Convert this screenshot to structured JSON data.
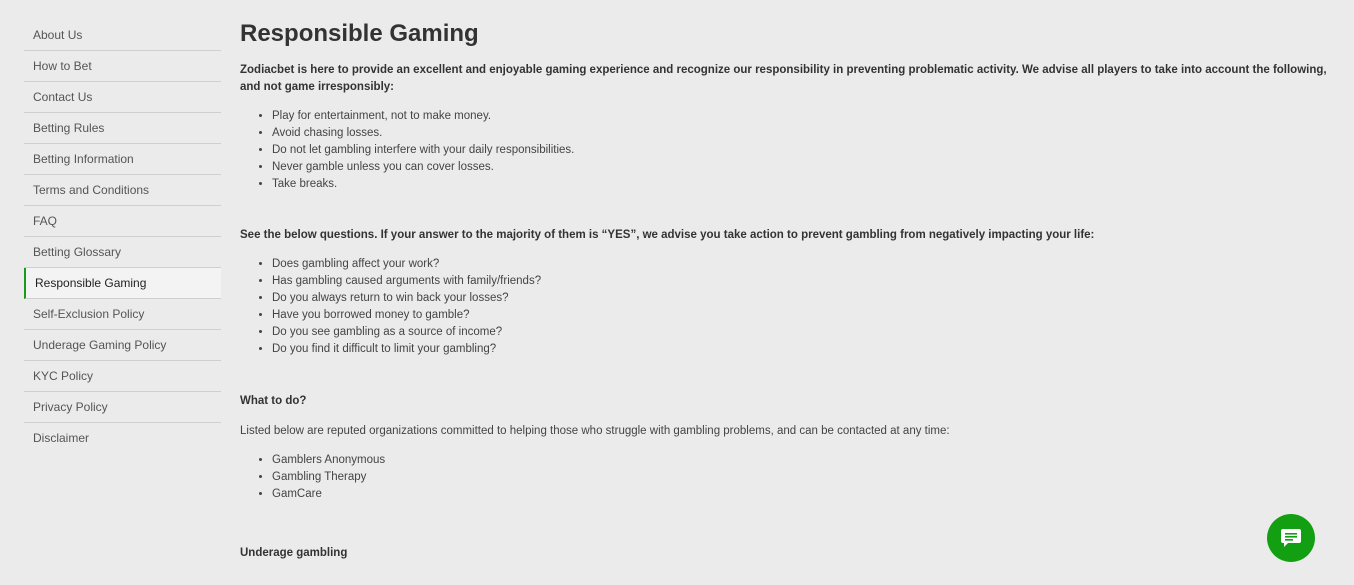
{
  "sidebar": {
    "items": [
      {
        "label": "About Us"
      },
      {
        "label": "How to Bet"
      },
      {
        "label": "Contact Us"
      },
      {
        "label": "Betting Rules"
      },
      {
        "label": "Betting Information"
      },
      {
        "label": "Terms and Conditions"
      },
      {
        "label": "FAQ"
      },
      {
        "label": "Betting Glossary"
      },
      {
        "label": "Responsible Gaming",
        "active": true
      },
      {
        "label": "Self-Exclusion Policy"
      },
      {
        "label": "Underage Gaming Policy"
      },
      {
        "label": "KYC Policy"
      },
      {
        "label": "Privacy Policy"
      },
      {
        "label": "Disclaimer"
      }
    ]
  },
  "main": {
    "title": "Responsible Gaming",
    "intro": "Zodiacbet is here to provide an excellent and enjoyable gaming experience and recognize our responsibility in preventing problematic activity. We advise all players to take into account the following, and not game irresponsibly:",
    "advice": [
      "Play for entertainment, not to make money.",
      "Avoid chasing losses.",
      "Do not let gambling interfere with your daily responsibilities.",
      "Never gamble unless you can cover losses.",
      "Take breaks."
    ],
    "questions_intro": "See the below questions. If your answer to the majority of them is “YES”, we advise you take action to prevent gambling from negatively impacting your life:",
    "questions": [
      "Does gambling affect your work?",
      "Has gambling caused arguments with family/friends?",
      "Do you always return to win back your losses?",
      "Have you borrowed money to gamble?",
      "Do you see gambling as a source of income?",
      "Do you find it difficult to limit your gambling?"
    ],
    "what_to_do": "What to do?",
    "organizations_intro": "Listed below are reputed organizations committed to helping those who struggle with gambling problems, and can be contacted at any time:",
    "organizations": [
      "Gamblers Anonymous",
      "Gambling Therapy",
      "GamCare"
    ],
    "underage_heading": "Underage gambling"
  },
  "chat": {
    "icon": "chat-bubble-icon",
    "color": "#12a012"
  },
  "colors": {
    "background": "#ebebeb",
    "active_accent": "#1a9a1a"
  }
}
